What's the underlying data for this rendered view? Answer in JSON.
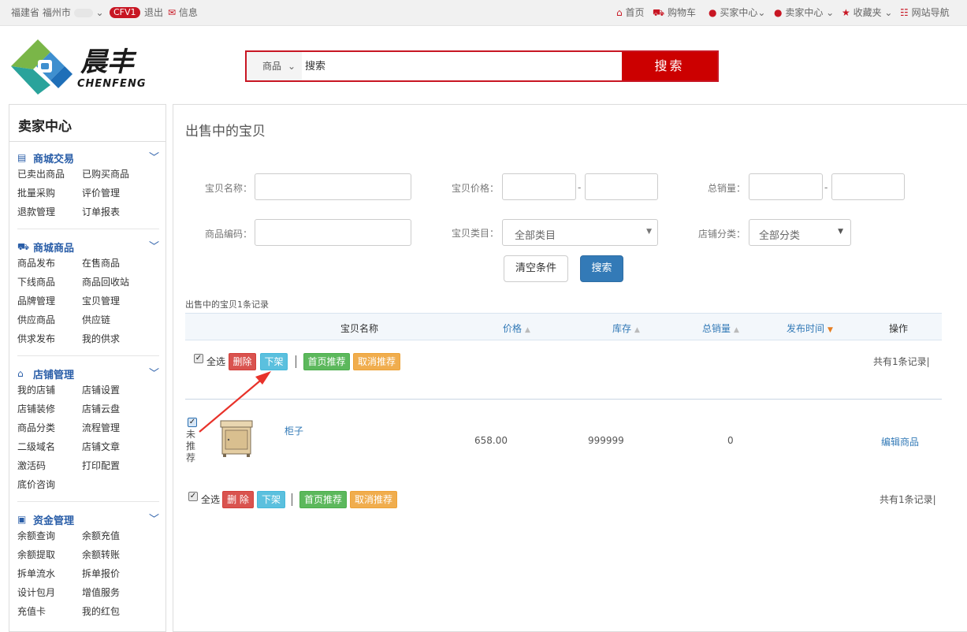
{
  "topbar": {
    "location": "福建省 福州市",
    "chevron": "⌄",
    "badge": "CFV1",
    "logout": "退出",
    "message": "信息",
    "home": "首页",
    "cart": "购物车",
    "buyer": "买家中心",
    "seller": "卖家中心",
    "favorites": "收藏夹",
    "sitenav": "网站导航"
  },
  "logo": {
    "cn": "晨丰",
    "en": "CHENFENG"
  },
  "search": {
    "category": "商品",
    "placeholder": "搜索",
    "button": "搜索"
  },
  "sidebar": {
    "title": "卖家中心",
    "groups": [
      {
        "title": "商城交易",
        "items": [
          "已卖出商品",
          "已购买商品",
          "批量采购",
          "评价管理",
          "退款管理",
          "订单报表"
        ]
      },
      {
        "title": "商城商品",
        "items": [
          "商品发布",
          "在售商品",
          "下线商品",
          "商品回收站",
          "品牌管理",
          "宝贝管理",
          "供应商品",
          "供应链",
          "供求发布",
          "我的供求"
        ]
      },
      {
        "title": "店铺管理",
        "items": [
          "我的店铺",
          "店铺设置",
          "店铺装修",
          "店铺云盘",
          "商品分类",
          "流程管理",
          "二级域名",
          "店铺文章",
          "激活码",
          "打印配置",
          "底价咨询"
        ]
      },
      {
        "title": "资金管理",
        "items": [
          "余额查询",
          "余额充值",
          "余额提取",
          "余额转账",
          "拆单流水",
          "拆单报价",
          "设计包月",
          "增值服务",
          "充值卡",
          "我的红包"
        ]
      }
    ]
  },
  "main": {
    "title": "出售中的宝贝",
    "filters": {
      "name": "宝贝名称：",
      "price": "宝贝价格：",
      "sales": "总销量：",
      "code": "商品编码：",
      "category": "宝贝类目：",
      "category_value": "全部类目",
      "shopcat": "店铺分类：",
      "shopcat_value": "全部分类",
      "dash": "-"
    },
    "clear_btn": "清空条件",
    "search_btn": "搜索",
    "record_count": "出售中的宝贝1条记录",
    "headers": {
      "name": "宝贝名称",
      "price": "价格",
      "stock": "库存",
      "sales": "总销量",
      "time": "发布时间",
      "op": "操作"
    },
    "toolbar": {
      "select_all": "全选",
      "delete": "删除",
      "delete_spaced": "删 除",
      "offline": "下架",
      "recommend": "首页推荐",
      "cancel_recommend": "取消推荐",
      "total": "共有1条记录|"
    },
    "row": {
      "status": "未推荐",
      "name": "柜子",
      "price": "658.00",
      "stock": "999999",
      "sales": "0",
      "op": "编辑商品"
    }
  },
  "colors": {
    "brand_red": "#c81623",
    "link_blue": "#337ab7",
    "group_blue": "#2a5ea8"
  },
  "icons": {
    "home": "home-icon",
    "cart": "cart-icon",
    "user": "user-icon",
    "star": "star-icon",
    "grid": "grid-icon",
    "envelope": "envelope-icon"
  }
}
